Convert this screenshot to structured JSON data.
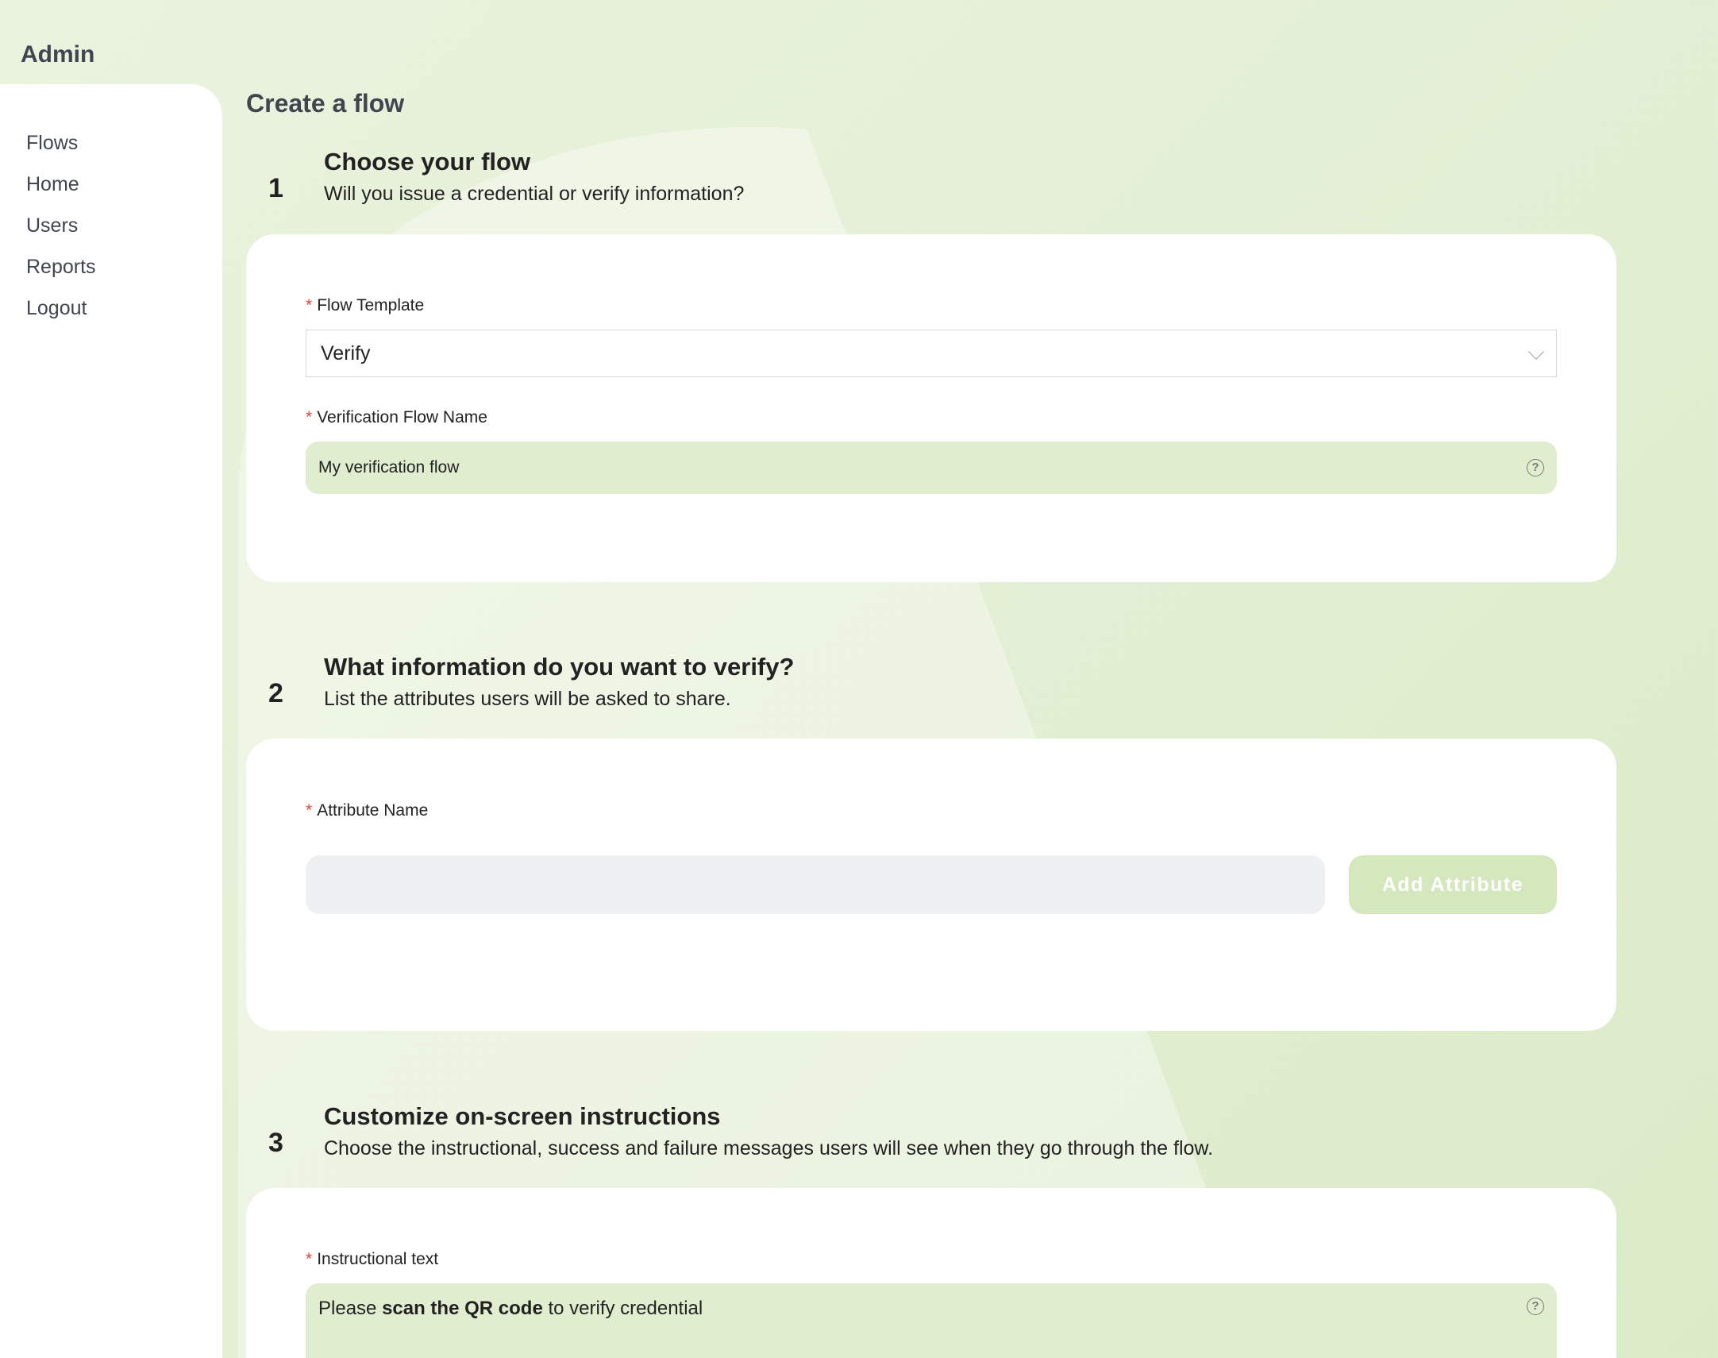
{
  "app": {
    "title": "Admin"
  },
  "sidebar": {
    "items": [
      {
        "label": "Flows"
      },
      {
        "label": "Home"
      },
      {
        "label": "Users"
      },
      {
        "label": "Reports"
      },
      {
        "label": "Logout"
      }
    ]
  },
  "page": {
    "title": "Create a flow"
  },
  "steps": [
    {
      "number": "1",
      "title": "Choose your flow",
      "subtitle": "Will you issue a credential or verify information?",
      "fields": {
        "flow_template_label": "Flow Template",
        "flow_template_value": "Verify",
        "flow_name_label": "Verification Flow Name",
        "flow_name_value": "My verification flow"
      }
    },
    {
      "number": "2",
      "title": "What information do you want to verify?",
      "subtitle": "List the attributes users will be asked to share.",
      "fields": {
        "attribute_name_label": "Attribute Name",
        "attribute_name_value": "",
        "add_button_label": "Add Attribute"
      }
    },
    {
      "number": "3",
      "title": "Customize on-screen instructions",
      "subtitle": "Choose the instructional, success and failure messages users will see when they go through the flow.",
      "fields": {
        "instructional_label": "Instructional text",
        "instructional_prefix": "Please ",
        "instructional_bold": "scan the QR code",
        "instructional_suffix": " to verify credential"
      }
    }
  ],
  "required_marker": "*",
  "icons": {
    "help": "help-circle-icon",
    "chevron": "chevron-down-icon"
  },
  "colors": {
    "background": "#e3efd4",
    "input_green": "#e1edcf",
    "button": "#d4e7bd",
    "required": "#e0453a"
  }
}
